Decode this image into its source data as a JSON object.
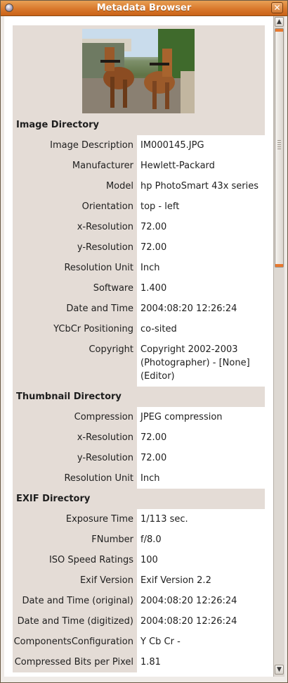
{
  "window": {
    "title": "Metadata Browser",
    "close_glyph": "✕"
  },
  "photo": {
    "alt": ""
  },
  "sections": [
    {
      "title": "Image Directory",
      "rows": [
        {
          "label": "Image Description",
          "value": "IM000145.JPG"
        },
        {
          "label": "Manufacturer",
          "value": "Hewlett-Packard"
        },
        {
          "label": "Model",
          "value": "hp PhotoSmart 43x series"
        },
        {
          "label": "Orientation",
          "value": "top - left"
        },
        {
          "label": "x-Resolution",
          "value": "72.00"
        },
        {
          "label": "y-Resolution",
          "value": "72.00"
        },
        {
          "label": "Resolution Unit",
          "value": "Inch"
        },
        {
          "label": "Software",
          "value": "1.400"
        },
        {
          "label": "Date and Time",
          "value": "2004:08:20 12:26:24"
        },
        {
          "label": "YCbCr Positioning",
          "value": "co-sited"
        },
        {
          "label": "Copyright",
          "value": "Copyright 2002-2003\n(Photographer) - [None]\n(Editor)"
        }
      ]
    },
    {
      "title": "Thumbnail Directory",
      "rows": [
        {
          "label": "Compression",
          "value": "JPEG compression"
        },
        {
          "label": "x-Resolution",
          "value": "72.00"
        },
        {
          "label": "y-Resolution",
          "value": "72.00"
        },
        {
          "label": "Resolution Unit",
          "value": "Inch"
        }
      ]
    },
    {
      "title": "EXIF Directory",
      "rows": [
        {
          "label": "Exposure Time",
          "value": "1/113 sec."
        },
        {
          "label": "FNumber",
          "value": "f/8.0"
        },
        {
          "label": "ISO Speed Ratings",
          "value": "100"
        },
        {
          "label": "Exif Version",
          "value": "Exif Version 2.2"
        },
        {
          "label": "Date and Time (original)",
          "value": "2004:08:20 12:26:24"
        },
        {
          "label": "Date and Time (digitized)",
          "value": "2004:08:20 12:26:24"
        },
        {
          "label": "ComponentsConfiguration",
          "value": "Y Cb Cr -"
        },
        {
          "label": "Compressed Bits per Pixel",
          "value": "1.81"
        }
      ]
    }
  ],
  "scrollbar": {
    "up": "▲",
    "down": "▼"
  },
  "icons": {
    "menu": "window-menu-icon",
    "close": "close-icon"
  },
  "colors": {
    "titlebar": "#d9782c",
    "label_bg": "#e4dcd6",
    "value_bg": "#ffffff",
    "scroll_accent": "#e8782e"
  }
}
